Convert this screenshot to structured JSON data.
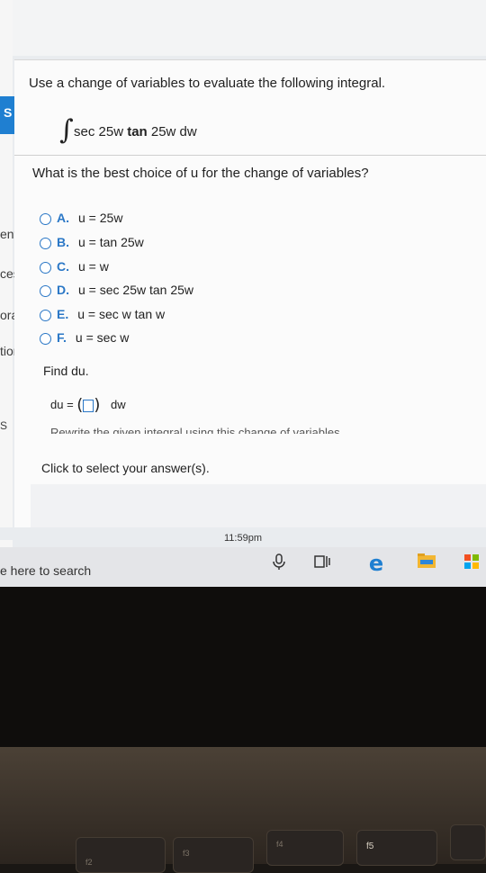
{
  "left_sidebar": {
    "tab_label": "S",
    "partial_labels": [
      "ent",
      "ces",
      "ora",
      "tion",
      "S"
    ]
  },
  "question": {
    "prompt": "Use a change of variables to evaluate the following integral.",
    "integral_sign": "∫",
    "integrand_prefix": "sec 25w ",
    "integrand_bold": "tan",
    "integrand_suffix": " 25w dw",
    "sub_prompt": "What is the best choice of u for the change of variables?"
  },
  "options": [
    {
      "letter": "A.",
      "text": "u = 25w"
    },
    {
      "letter": "B.",
      "text": "u = tan 25w"
    },
    {
      "letter": "C.",
      "text": "u = w"
    },
    {
      "letter": "D.",
      "text": "u = sec 25w tan 25w"
    },
    {
      "letter": "E.",
      "text": "u = sec w tan w"
    },
    {
      "letter": "F.",
      "text": "u = sec w"
    }
  ],
  "find_du": {
    "label": "Find du.",
    "du_label": "du =",
    "open_paren": "(",
    "close_paren": ")",
    "suffix": "dw"
  },
  "cut_off_text": "Rewrite the given integral using this change of variables",
  "instruction": "Click to select your answer(s).",
  "clock": "11:59pm",
  "taskbar": {
    "search_text": "e here to search",
    "icons": [
      "microphone-icon",
      "task-view-icon",
      "edge-icon",
      "file-explorer-icon",
      "store-icon"
    ]
  },
  "keyboard": {
    "function_keys": [
      "f2",
      "f3",
      "f4",
      "f5"
    ]
  }
}
